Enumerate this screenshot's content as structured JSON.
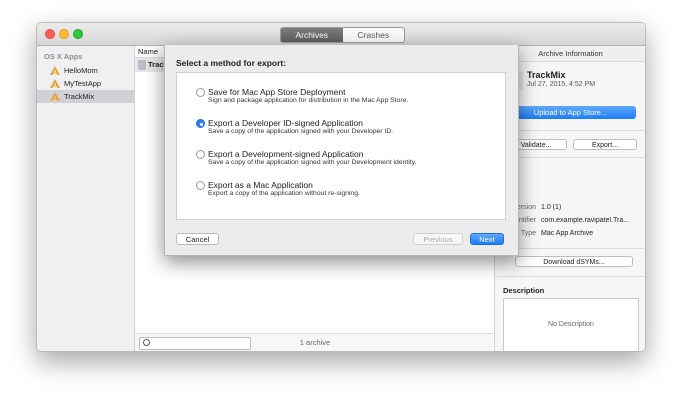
{
  "window": {
    "segments": [
      {
        "label": "Archives",
        "active": true
      },
      {
        "label": "Crashes",
        "active": false
      }
    ]
  },
  "sidebar": {
    "heading": "OS X Apps",
    "items": [
      {
        "label": "HelloMom",
        "selected": false
      },
      {
        "label": "MyTestApp",
        "selected": false
      },
      {
        "label": "TrackMix",
        "selected": true
      }
    ]
  },
  "list": {
    "column_header": "Name",
    "first_row": "Track",
    "archive_count": "1 archive"
  },
  "info_panel": {
    "header": "Archive Information",
    "app_name": "TrackMix",
    "app_date": "Jul 27, 2015, 4:52 PM",
    "upload_label": "Upload to App Store...",
    "validate_label": "Validate...",
    "export_label": "Export...",
    "details_heading": "ils",
    "details": [
      {
        "label": "Version",
        "value": "1.0 (1)"
      },
      {
        "label": "entifier",
        "value": "com.example.ravipatel.Tra..."
      },
      {
        "label": "Type",
        "value": "Mac App Archive"
      }
    ],
    "download_dsyms_label": "Download dSYMs...",
    "description_heading": "Description",
    "description_placeholder": "No Description"
  },
  "export_sheet": {
    "title": "Select a method for export:",
    "options": [
      {
        "title": "Save for Mac App Store Deployment",
        "description": "Sign and package application for distribution in the Mac App Store.",
        "selected": false
      },
      {
        "title": "Export a Developer ID-signed Application",
        "description": "Save a copy of the application signed with your Developer ID.",
        "selected": true
      },
      {
        "title": "Export a Development-signed Application",
        "description": "Save a copy of the application signed with your Development identity.",
        "selected": false
      },
      {
        "title": "Export as a Mac Application",
        "description": "Export a copy of the application without re-signing.",
        "selected": false
      }
    ],
    "cancel_label": "Cancel",
    "previous_label": "Previous",
    "next_label": "Next"
  },
  "colors": {
    "accent": "#2b80f5",
    "app_icon": "#e8a53a"
  }
}
